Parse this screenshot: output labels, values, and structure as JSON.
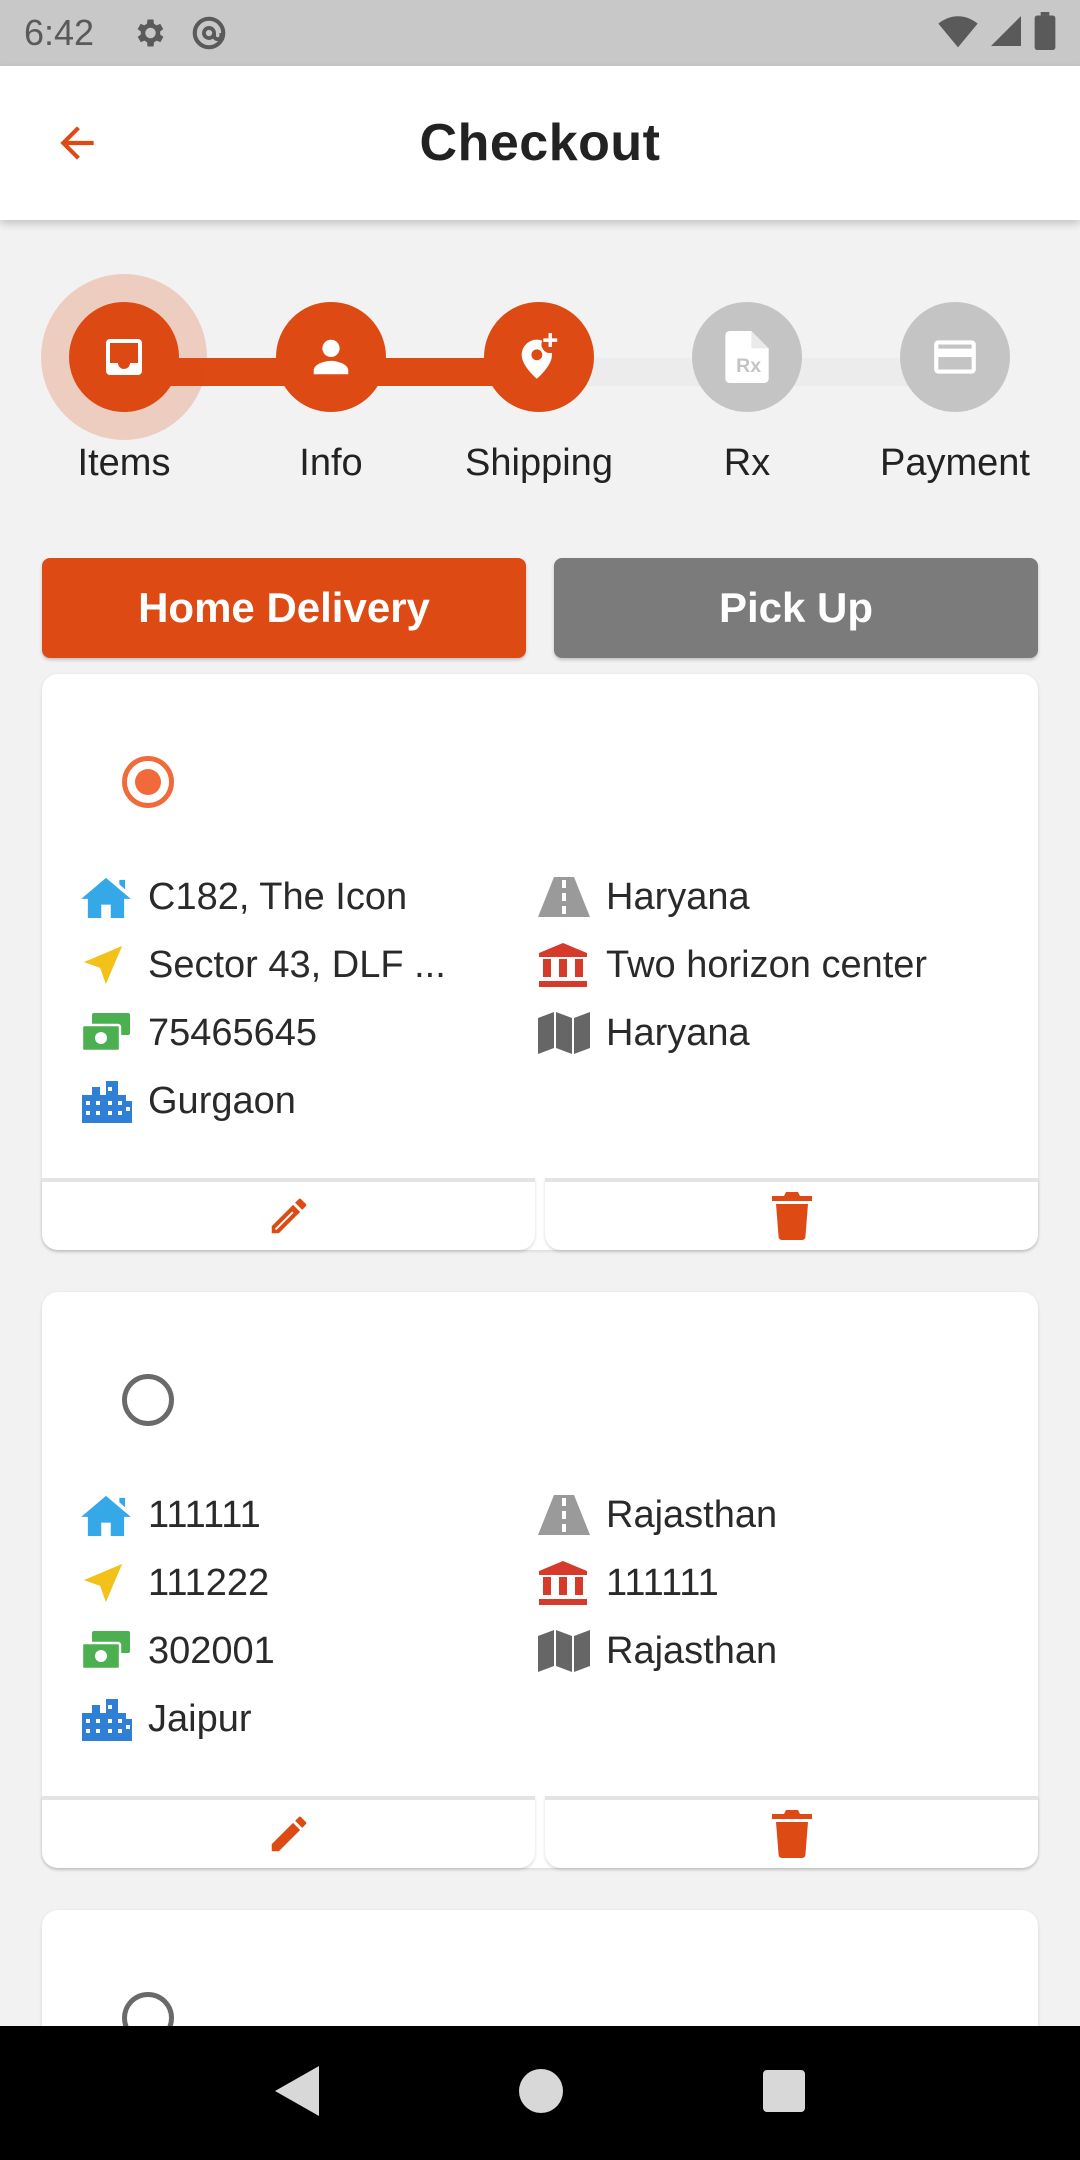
{
  "status_bar": {
    "time": "6:42"
  },
  "app_bar": {
    "title": "Checkout"
  },
  "stepper": {
    "steps": [
      {
        "label": "Items",
        "state": "current",
        "icon": "inbox-icon"
      },
      {
        "label": "Info",
        "state": "done",
        "icon": "person-icon"
      },
      {
        "label": "Shipping",
        "state": "done",
        "icon": "add-location-icon"
      },
      {
        "label": "Rx",
        "state": "pending",
        "icon": "prescription-file-icon"
      },
      {
        "label": "Payment",
        "state": "pending",
        "icon": "credit-card-icon"
      }
    ]
  },
  "tabs": {
    "home_delivery": "Home Delivery",
    "pick_up": "Pick Up",
    "selected": "Home Delivery"
  },
  "addresses": [
    {
      "selected": true,
      "house": "C182, The Icon",
      "street": "Sector 43, DLF ...",
      "pincode": "75465645",
      "city": "Gurgaon",
      "state_road": "Haryana",
      "landmark": "Two horizon center",
      "state": "Haryana"
    },
    {
      "selected": false,
      "house": "111111",
      "street": "111222",
      "pincode": "302001",
      "city": "Jaipur",
      "state_road": "Rajasthan",
      "landmark": "111111",
      "state": "Rajasthan"
    },
    {
      "selected": false
    }
  ],
  "colors": {
    "accent": "#dd4a14",
    "inactive": "#c4c4c4",
    "home_icon": "#35a8e8",
    "street_icon": "#f2c21a",
    "pincode_icon": "#4caf50",
    "city_icon": "#2f7fd6",
    "road_icon": "#9a9a9a",
    "landmark_icon": "#d63a2a",
    "map_icon": "#666666"
  }
}
